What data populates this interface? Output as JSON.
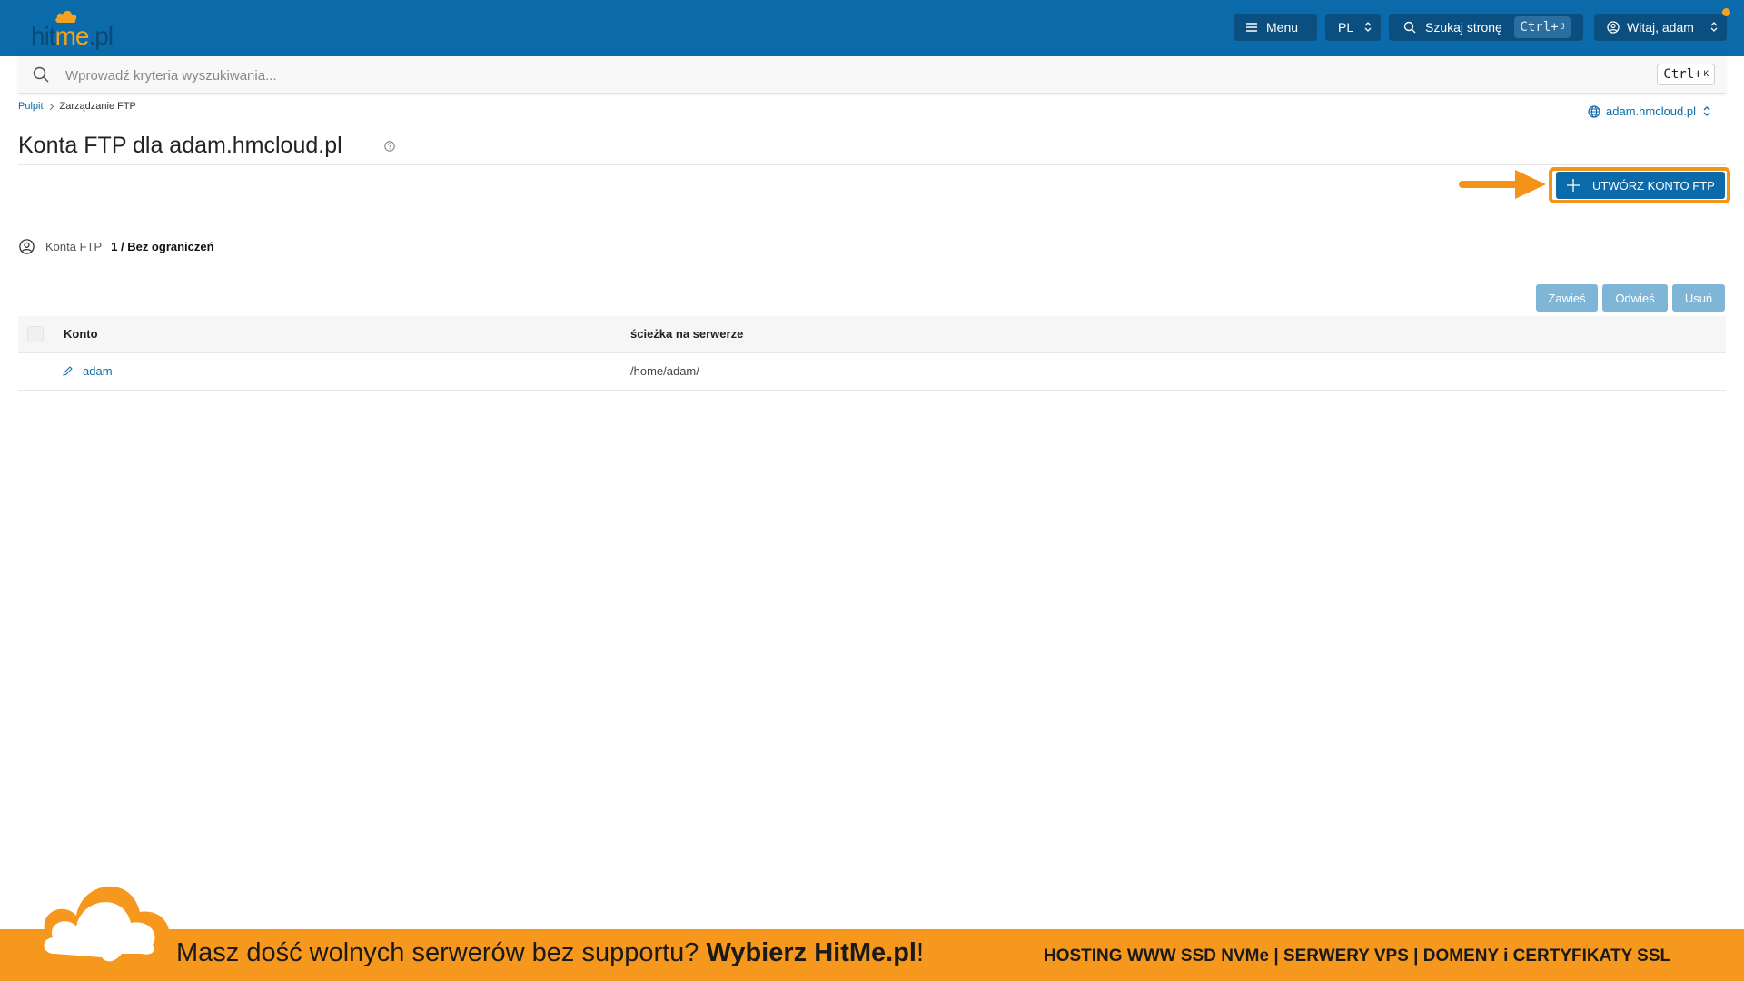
{
  "brand": {
    "logo_text_prefix": "hit",
    "logo_text_accent": "me",
    "logo_text_suffix": ".pl",
    "primary_color": "#0b6aa9",
    "accent_color": "#f39318"
  },
  "topbar": {
    "menu_label": "Menu",
    "lang_label": "PL",
    "search_label": "Szukaj stronę",
    "search_shortcut_key": "Ctrl+",
    "search_shortcut_letter": "J",
    "user_greeting": "Witaj, adam"
  },
  "search": {
    "placeholder": "Wprowadź kryteria wyszukiwania...",
    "shortcut_key": "Ctrl+",
    "shortcut_letter": "K"
  },
  "breadcrumb": {
    "home": "Pulpit",
    "current": "Zarządzanie FTP"
  },
  "domain_selector": {
    "label": "adam.hmcloud.pl"
  },
  "page": {
    "title": "Konta FTP dla adam.hmcloud.pl",
    "create_button": "UTWÓRZ KONTO FTP"
  },
  "stats": {
    "label": "Konta FTP",
    "value": "1 / Bez ograniczeń"
  },
  "actions": {
    "suspend": "Zawieś",
    "unsuspend": "Odwieś",
    "delete": "Usuń"
  },
  "table": {
    "headers": [
      "Konto",
      "ścieżka na serwerze"
    ],
    "rows": [
      {
        "account": "adam",
        "path": "/home/adam/"
      }
    ]
  },
  "banner": {
    "message_plain": "Masz dość wolnych serwerów bez supportu? ",
    "message_bold": "Wybierz HitMe.pl",
    "message_end": "!",
    "services": "HOSTING WWW SSD NVMe | SERWERY VPS | DOMENY i CERTYFIKATY SSL"
  }
}
